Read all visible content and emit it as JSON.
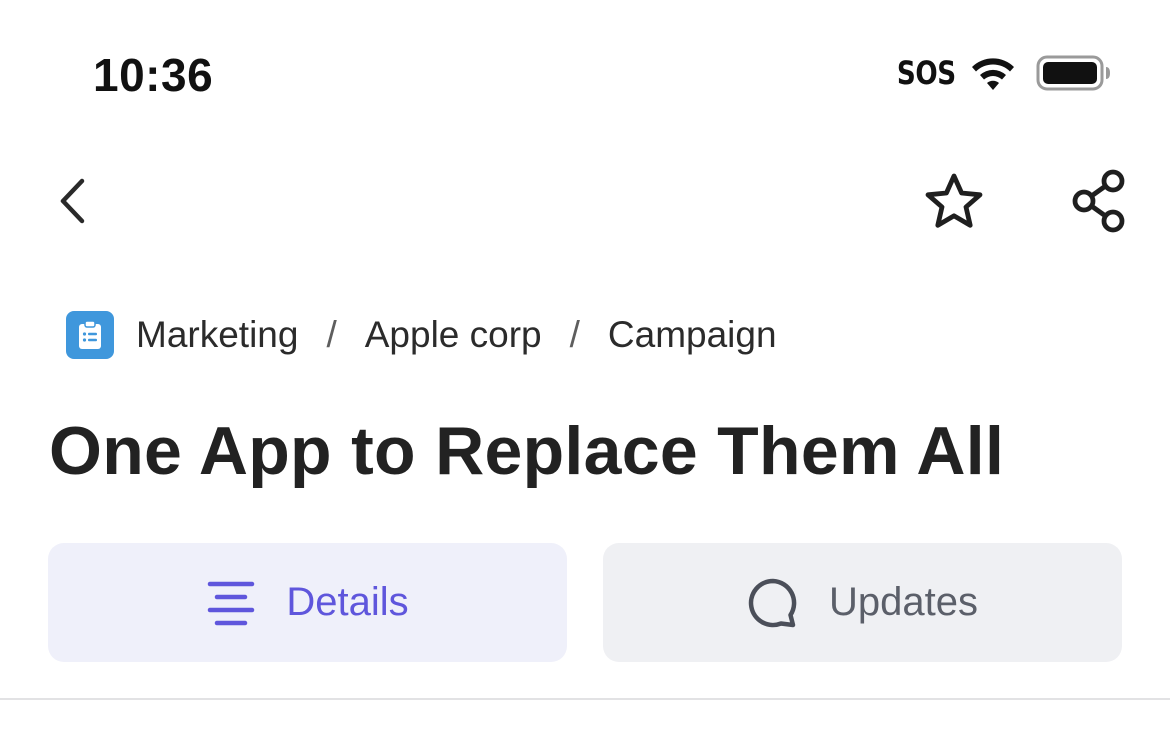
{
  "status_bar": {
    "time": "10:36",
    "sos": "SOS",
    "icons": [
      "wifi-icon",
      "battery-icon"
    ]
  },
  "nav": {
    "icons": [
      "chevron-left-icon",
      "star-icon",
      "share-icon"
    ]
  },
  "breadcrumb": {
    "icon": "clipboard-icon",
    "icon_color": "#3f97dc",
    "items": [
      "Marketing",
      "Apple corp",
      "Campaign"
    ],
    "separator": "/"
  },
  "page": {
    "title": "One App to Replace Them All"
  },
  "tabs": [
    {
      "label": "Details",
      "icon": "lines-icon",
      "active": true,
      "color": "#5f56dc"
    },
    {
      "label": "Updates",
      "icon": "chat-bubble-icon",
      "active": false,
      "color": "#5b5f69"
    }
  ]
}
